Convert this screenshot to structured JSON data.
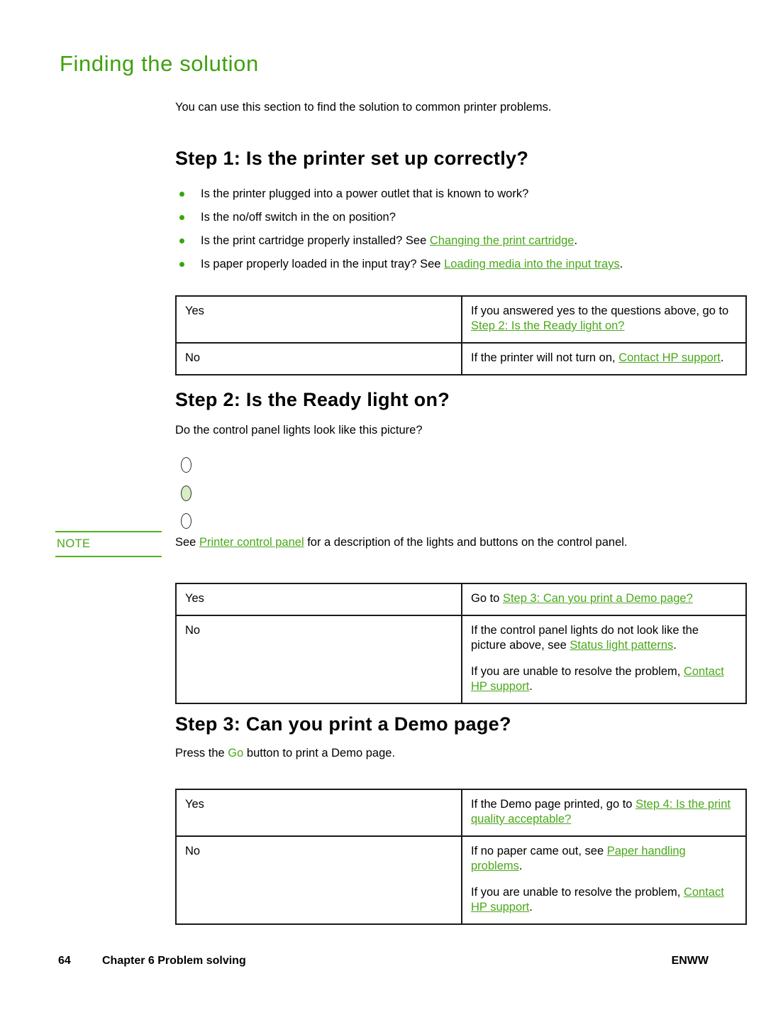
{
  "page": {
    "title": "Finding the solution",
    "intro": "You can use this section to find the solution to common printer problems."
  },
  "step1": {
    "heading": "Step 1: Is the printer set up correctly?",
    "bullets": [
      {
        "text_before": "Is the printer plugged into a power outlet that is known to work?",
        "link": "",
        "text_after": ""
      },
      {
        "text_before": "Is the no/off switch in the on position?",
        "link": "",
        "text_after": ""
      },
      {
        "text_before": "Is the print cartridge properly installed? See ",
        "link": "Changing the print cartridge",
        "text_after": "."
      },
      {
        "text_before": "Is paper properly loaded in the input tray? See ",
        "link": "Loading media into the input trays",
        "text_after": "."
      }
    ],
    "table": {
      "yes_label": "Yes",
      "no_label": "No",
      "yes_text_before": "If you answered yes to the questions above, go to ",
      "yes_link": "Step 2: Is the Ready light on?",
      "yes_text_after": "",
      "no_text_before": "If the printer will not turn on, ",
      "no_link": "Contact HP support",
      "no_text_after": "."
    }
  },
  "step2": {
    "heading": "Step 2: Is the Ready light on?",
    "intro": "Do the control panel lights look like this picture?",
    "lights": [
      {
        "name": "attention-light",
        "state": "off"
      },
      {
        "name": "ready-light",
        "state": "on"
      },
      {
        "name": "go-light",
        "state": "off"
      }
    ],
    "note": {
      "label": "NOTE",
      "text_before": "See ",
      "link": "Printer control panel",
      "text_after": " for a description of the lights and buttons on the control panel."
    },
    "table": {
      "yes_label": "Yes",
      "no_label": "No",
      "yes_text_before": "Go to ",
      "yes_link": "Step 3: Can you print a Demo page?",
      "yes_text_after": "",
      "no_p1_before": "If the control panel lights do not look like the picture above, see ",
      "no_p1_link": "Status light patterns",
      "no_p1_after": ".",
      "no_p2_before": "If you are unable to resolve the problem, ",
      "no_p2_link": "Contact HP support",
      "no_p2_after": "."
    }
  },
  "step3": {
    "heading": "Step 3: Can you print a Demo page?",
    "intro_before": "Press the ",
    "intro_highlight": "Go",
    "intro_after": " button to print a Demo page.",
    "table": {
      "yes_label": "Yes",
      "no_label": "No",
      "yes_text_before": "If the Demo page printed, go to ",
      "yes_link": "Step 4: Is the print quality acceptable?",
      "yes_text_after": "",
      "no_p1_before": "If no paper came out, see ",
      "no_p1_link": "Paper handling problems",
      "no_p1_after": ".",
      "no_p2_before": "If you are unable to resolve the problem, ",
      "no_p2_link": "Contact HP support",
      "no_p2_after": "."
    }
  },
  "footer": {
    "page_number": "64",
    "chapter": "Chapter 6  Problem solving",
    "locale": "ENWW"
  },
  "colors": {
    "heading_green": "#3fa00e",
    "link_green": "#4aa81a",
    "bullet_green": "#37a60a",
    "led_on": "#d8edc3",
    "border_dark": "#1a1a1a"
  }
}
